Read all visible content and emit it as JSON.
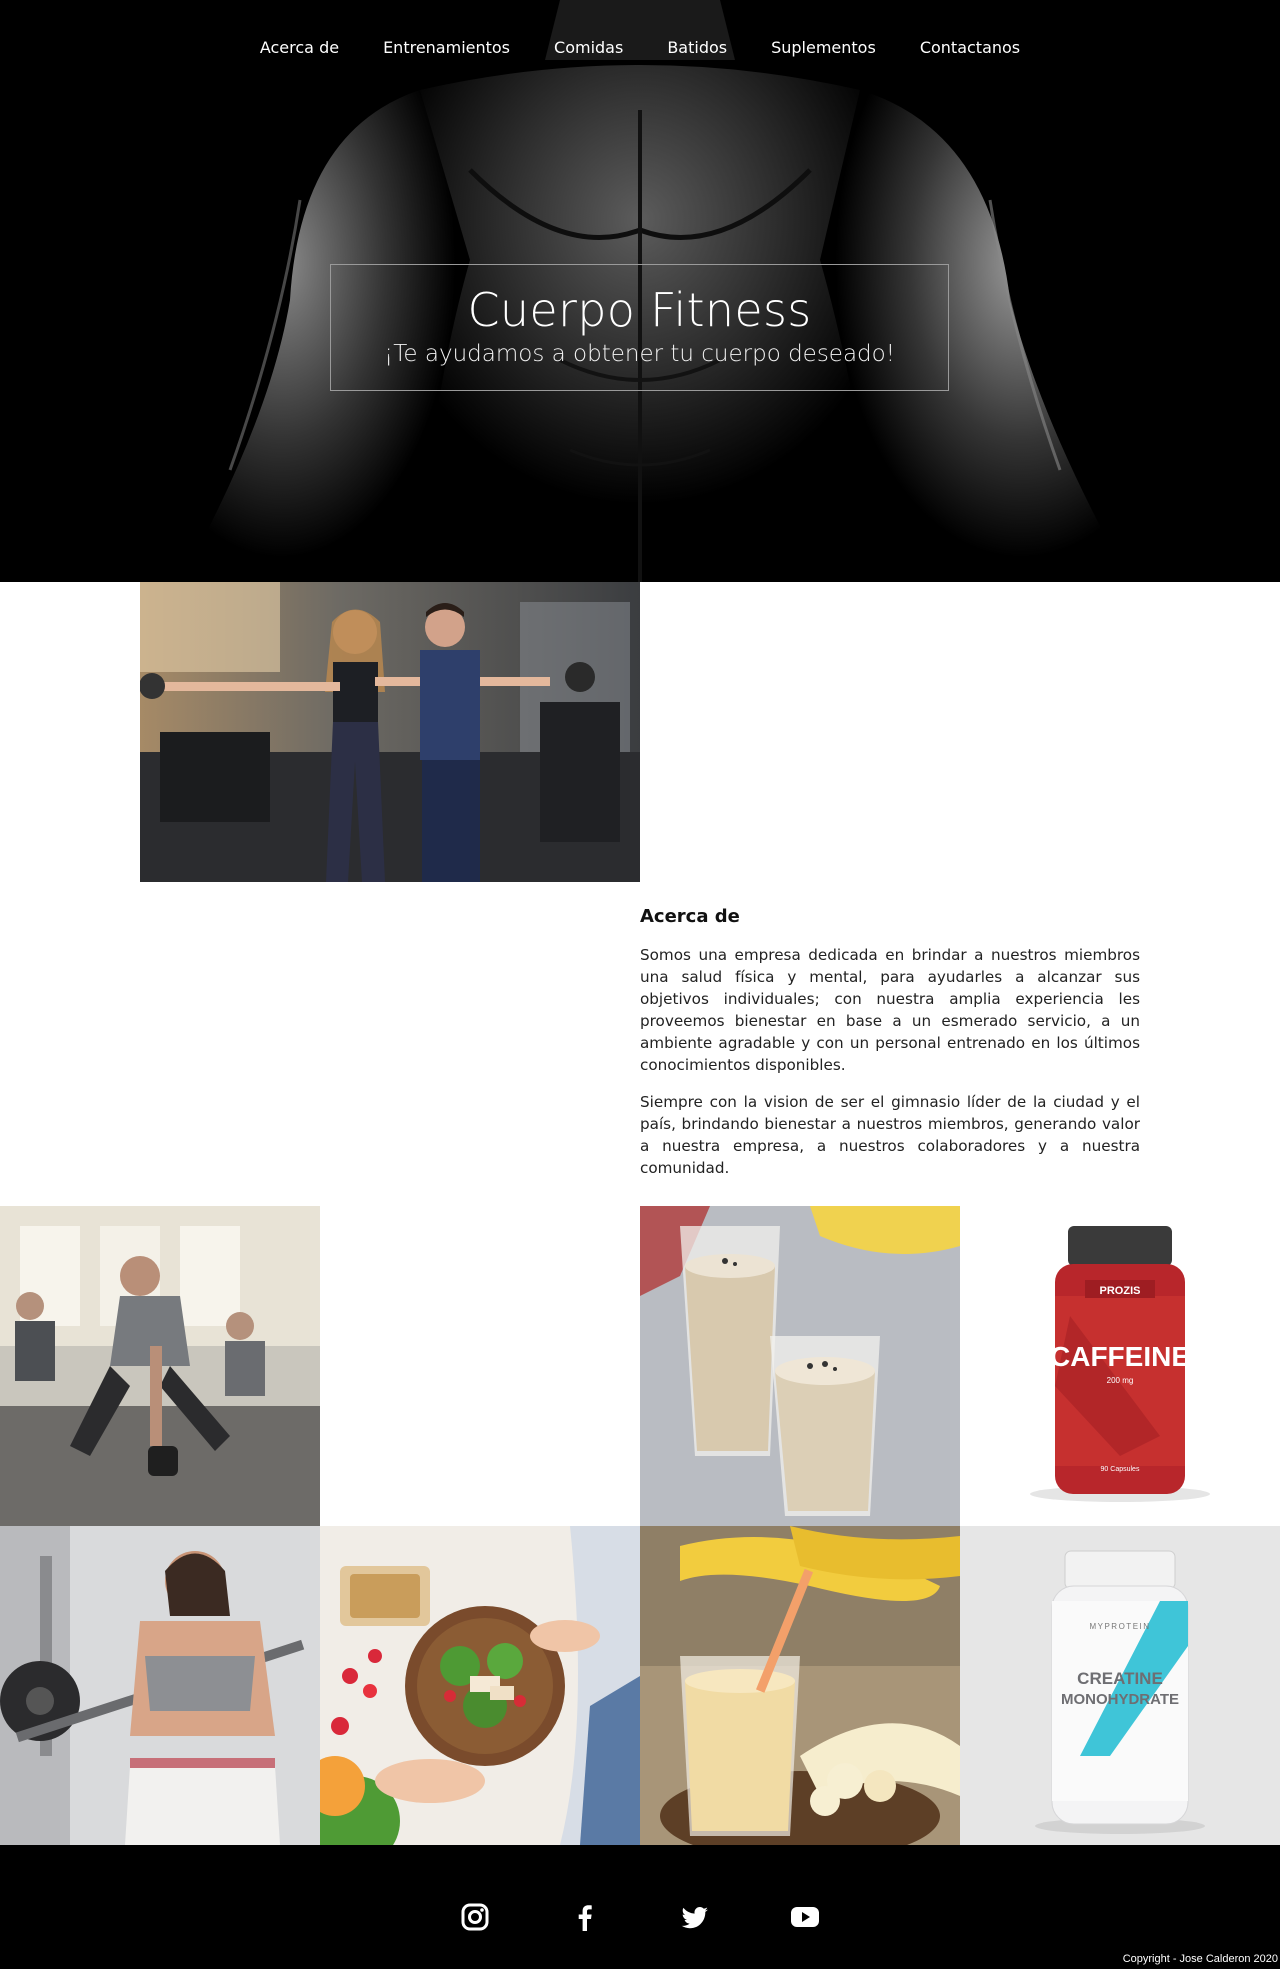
{
  "nav": {
    "items": [
      "Acerca de",
      "Entrenamientos",
      "Comidas",
      "Batidos",
      "Suplementos",
      "Contactanos"
    ]
  },
  "hero": {
    "title": "Cuerpo Fitness",
    "subtitle": "¡Te ayudamos a obtener tu cuerpo deseado!"
  },
  "about": {
    "heading": "Acerca de",
    "paragraphs": [
      "Somos una empresa dedicada en brindar a nuestros miembros una salud física y mental, para ayudarles a alcanzar sus objetivos individuales; con nuestra amplia experiencia les proveemos bienestar en base a un esmerado servicio, a un ambiente agradable y con un personal entrenado en los últimos conocimientos disponibles.",
      "Siempre con la vision de ser el gimnasio líder de la ciudad y el país, brindando bienestar a nuestros miembros, generando valor a nuestra empresa, a nuestros colaboradores y a nuestra comunidad."
    ]
  },
  "products": {
    "caffeine": {
      "brand": "PROZIS",
      "name": "CAFFEINE",
      "dose": "200 mg",
      "count": "90 Capsules"
    },
    "creatine": {
      "brand": "MYPROTEIN",
      "name_line1": "CREATINE",
      "name_line2": "MONOHYDRATE"
    }
  },
  "footer": {
    "social_icons": [
      "instagram-icon",
      "facebook-icon",
      "twitter-icon",
      "youtube-icon"
    ],
    "copyright": "Copyright - Jose Calderon 2020"
  },
  "colors": {
    "hero_bg": "#000000",
    "footer_bg": "#000000",
    "accent_red": "#c8262c",
    "creatine_cyan": "#3fc5d8"
  }
}
